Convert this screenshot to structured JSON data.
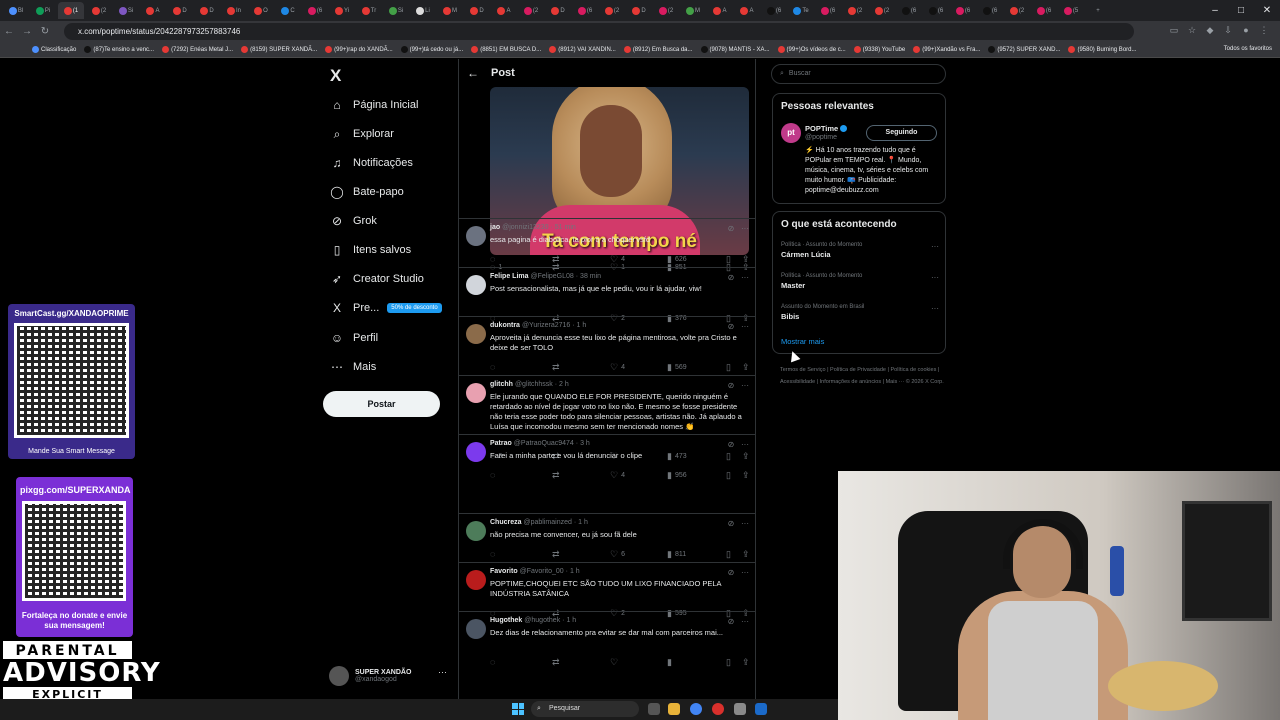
{
  "browser": {
    "url": "x.com/poptime/status/2042287973257883746",
    "tabs": [
      "Bl",
      "Pi",
      "(1",
      "(2",
      "Si",
      "A",
      "D",
      "D",
      "In",
      "O",
      "C",
      "(6",
      "Yi",
      "Tr",
      "Si",
      "Li",
      "M",
      "D",
      "A",
      "(2",
      "D",
      "(6",
      "(2",
      "D",
      "(2",
      "M",
      "A",
      "A",
      "(6",
      "Te",
      "(6",
      "(2",
      "(2",
      "(6",
      "(6",
      "(6",
      "(6",
      "(2",
      "(6",
      "(5"
    ],
    "bookmarks": [
      "Classificação",
      "(87)Te ensino a venc...",
      "(7292) Enéas Metal J...",
      "(8159) SUPER XANDÃ...",
      "(99+)rap do XANDÃ...",
      "(99+)tá cedo ou já...",
      "(8851) EM BUSCA D...",
      "(8912) VAI XANDIN...",
      "(8912) Em Busca da...",
      "(9078) MANTIS - XA...",
      "(99+)Os vídeos de c...",
      "(9338) YouTube",
      "(99+)Xandão vs Fra...",
      "(9572) SUPER XAND...",
      "(9580) Burning Bord..."
    ],
    "bookmarks_all": "Todos os favoritos"
  },
  "overlay": {
    "card1_title": "SmartCast.gg/XANDAOPRIME",
    "card1_bottom": "Mande Sua Smart Message",
    "card2_title": "pixgg.com/SUPERXANDA",
    "card2_bottom": "Fortaleça no donate e envie sua mensagem!",
    "advisory_top": "PARENTAL",
    "advisory_mid": "ADVISORY",
    "advisory_bottom": "EXPLICIT CONTENT"
  },
  "nav": {
    "logo": "X",
    "items": [
      {
        "label": "Página Inicial",
        "icon": "home-icon",
        "glyph": "⌂"
      },
      {
        "label": "Explorar",
        "icon": "search-icon",
        "glyph": "⌕"
      },
      {
        "label": "Notificações",
        "icon": "bell-icon",
        "glyph": "♫"
      },
      {
        "label": "Bate-papo",
        "icon": "chat-icon",
        "glyph": "◯"
      },
      {
        "label": "Grok",
        "icon": "grok-icon",
        "glyph": "⊘"
      },
      {
        "label": "Itens salvos",
        "icon": "bookmark-icon",
        "glyph": "▯"
      },
      {
        "label": "Creator Studio",
        "icon": "rocket-icon",
        "glyph": "➶"
      },
      {
        "label": "Pre...",
        "icon": "x-premium-icon",
        "glyph": "X"
      },
      {
        "label": "Perfil",
        "icon": "person-icon",
        "glyph": "☺"
      },
      {
        "label": "Mais",
        "icon": "more-circle-icon",
        "glyph": "⋯"
      }
    ],
    "premium_badge": "50% de desconto",
    "notif_count": "20+",
    "post_button": "Postar",
    "user": {
      "name": "SUPER XANDÃO",
      "handle": "@xandaogod"
    }
  },
  "main": {
    "header_title": "Post",
    "media_caption": "Ta com tempo né",
    "media_actions": {
      "replies": "1",
      "reposts": "",
      "likes": "1",
      "views": "851"
    },
    "replies": [
      {
        "name": "jao",
        "handle": "@jonnizi13230",
        "time": "51 min",
        "text": "essa pagina é diabolica, ta pior q a choquei vsfd",
        "replies": "",
        "likes": "4",
        "views": "626",
        "avatar": "#6b7280"
      },
      {
        "name": "Felipe Lima",
        "handle": "@FelipeGL08",
        "time": "38 min",
        "text": "Post sensacionalista, mas já que ele pediu, vou ir lá ajudar, viw!",
        "replies": "",
        "likes": "2",
        "views": "376",
        "avatar": "#d1d5db"
      },
      {
        "name": "dukontra",
        "handle": "@Yurizera2716",
        "time": "1 h",
        "text": "Aproveita já denuncia esse teu lixo de página mentirosa, volte pra Cristo e deixe de ser TOLO",
        "replies": "",
        "likes": "4",
        "views": "569",
        "avatar": "#8b6b4a"
      },
      {
        "name": "glitchh",
        "handle": "@glitchhssk",
        "time": "2 h",
        "text": "Ele jurando que QUANDO ELE FOR PRESIDENTE, querido ninguém é retardado ao nível de jogar voto no lixo não. E mesmo se fosse presidente não teria esse poder todo para silenciar pessoas, artistas não. Já aplaudo a Luísa que incomodou mesmo sem ter mencionado nomes 👏",
        "replies": "3",
        "likes": "",
        "views": "473",
        "avatar": "#e8a0b0"
      },
      {
        "name": "Patrao",
        "handle": "@PatraoQuac9474",
        "time": "3 h",
        "text": "Farei a minha parte e vou lá denunciar o clipe",
        "replies": "",
        "likes": "4",
        "views": "956",
        "avatar": "#7c3aed"
      },
      {
        "name": "Chucreza",
        "handle": "@pablimainzed",
        "time": "1 h",
        "text": "não precisa me convencer, eu já sou fã dele",
        "replies": "",
        "likes": "6",
        "views": "811",
        "avatar": "#4d7c5a"
      },
      {
        "name": "Favorito",
        "handle": "@Favorito_00",
        "time": "1 h",
        "text": "POPTIME,CHOQUEI ETC SÃO TUDO UM LIXO FINANCIADO PELA INDÚSTRIA SATÂNICA",
        "replies": "",
        "likes": "2",
        "views": "595",
        "avatar": "#b91c1c"
      },
      {
        "name": "Hugothek",
        "handle": "@hugothek",
        "time": "1 h",
        "text": "Dez dias de relacionamento pra evitar se dar mal com parceiros mai...",
        "replies": "",
        "likes": "",
        "views": "",
        "avatar": "#4b5563"
      }
    ]
  },
  "sidebar": {
    "search_placeholder": "Buscar",
    "relevant_title": "Pessoas relevantes",
    "profile": {
      "name": "POPTime",
      "handle": "@poptime",
      "avatar": "pt",
      "follow": "Seguindo",
      "bio": "⚡ Há 10 anos trazendo tudo que é POPular em TEMPO real. 📍 Mundo, música, cinema, tv, séries e celebs com muito humor. 📪 Publicidade: poptime@deubuzz.com"
    },
    "trends_title": "O que está acontecendo",
    "trends": [
      {
        "context": "Política · Assunto do Momento",
        "name": "Cármen Lúcia"
      },
      {
        "context": "Política · Assunto do Momento",
        "name": "Master"
      },
      {
        "context": "Assunto do Momento em Brasil",
        "name": "Bibis"
      }
    ],
    "show_more": "Mostrar mais",
    "footer": "Termos de Serviço  |  Política de Privacidade  |  Política de cookies  |  Acessibilidade  |  Informações de anúncios  |  Mais ···  © 2026 X Corp."
  },
  "taskbar": {
    "search_label": "Pesquisar"
  }
}
